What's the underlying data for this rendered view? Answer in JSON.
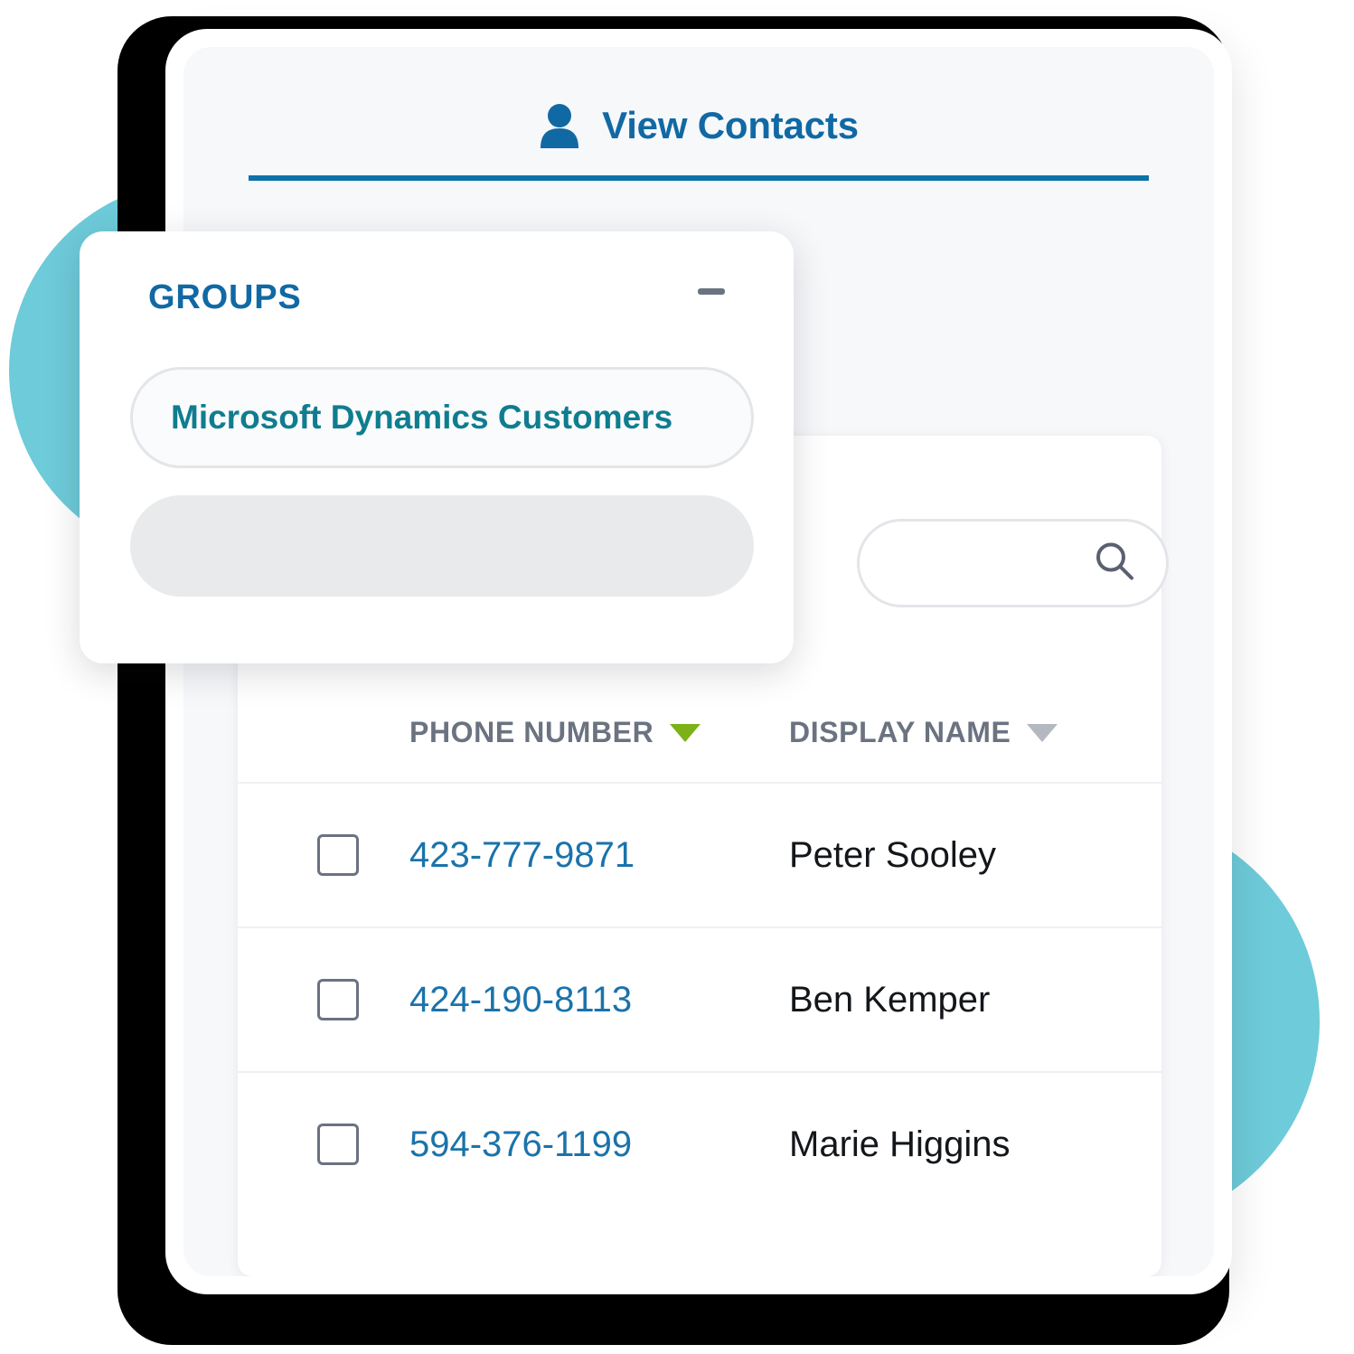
{
  "colors": {
    "accent_blue": "#1169a4",
    "tab_underline": "#0d72a8",
    "teal_text": "#0f7d8f",
    "decor_circle": "#6ecbd9",
    "link_blue": "#1a73ab",
    "sort_active_green": "#7cb217",
    "sort_inactive_gray": "#b4b8bf",
    "header_gray": "#6b7280"
  },
  "tab": {
    "label": "View Contacts",
    "icon": "person-icon"
  },
  "groups_panel": {
    "title": "GROUPS",
    "collapse_icon": "minus-icon",
    "items": [
      {
        "label": "Microsoft Dynamics Customers",
        "selected": true
      },
      {
        "label": "",
        "selected": false
      }
    ]
  },
  "search": {
    "value": "",
    "placeholder": "",
    "icon": "search-icon"
  },
  "table": {
    "columns": [
      {
        "key": "check",
        "label": "",
        "sort_icon": ""
      },
      {
        "key": "phone",
        "label": "PHONE NUMBER",
        "sort_icon": "caret-down-icon",
        "sort_active": true
      },
      {
        "key": "name",
        "label": "DISPLAY NAME",
        "sort_icon": "caret-down-icon",
        "sort_active": false
      }
    ],
    "rows": [
      {
        "checked": false,
        "phone": "423-777-9871",
        "name": "Peter Sooley"
      },
      {
        "checked": false,
        "phone": "424-190-8113",
        "name": "Ben Kemper"
      },
      {
        "checked": false,
        "phone": "594-376-1199",
        "name": "Marie Higgins"
      }
    ]
  }
}
